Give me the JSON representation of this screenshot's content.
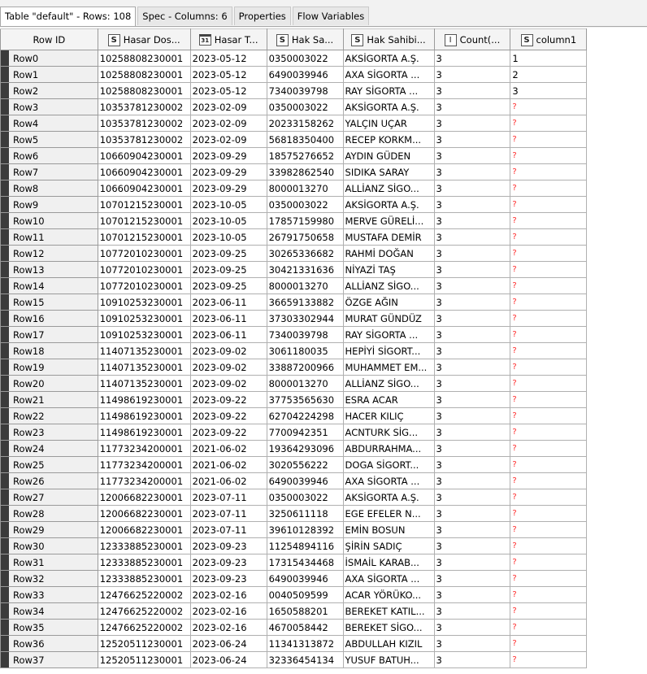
{
  "tabs": [
    {
      "label": "Table \"default\" - Rows: 108"
    },
    {
      "label": "Spec - Columns: 6"
    },
    {
      "label": "Properties"
    },
    {
      "label": "Flow Variables"
    }
  ],
  "columns": [
    {
      "label": "Row ID",
      "type": "",
      "icon": ""
    },
    {
      "label": "Hasar Dos...",
      "type": "S",
      "icon": "string-type-icon"
    },
    {
      "label": "Hasar T...",
      "type": "31",
      "icon": "date-type-icon"
    },
    {
      "label": "Hak Sa...",
      "type": "S",
      "icon": "string-type-icon"
    },
    {
      "label": "Hak Sahibi...",
      "type": "S",
      "icon": "string-type-icon"
    },
    {
      "label": "Count(...",
      "type": "I",
      "icon": "integer-type-icon"
    },
    {
      "label": "column1",
      "type": "S",
      "icon": "string-type-icon"
    }
  ],
  "rows": [
    [
      "Row0",
      "10258808230001",
      "2023-05-12",
      "0350003022",
      "AKSİGORTA A.Ş.",
      "3",
      "1"
    ],
    [
      "Row1",
      "10258808230001",
      "2023-05-12",
      "6490039946",
      "AXA SİGORTA ...",
      "3",
      "2"
    ],
    [
      "Row2",
      "10258808230001",
      "2023-05-12",
      "7340039798",
      "RAY SİGORTA ...",
      "3",
      "3"
    ],
    [
      "Row3",
      "10353781230002",
      "2023-02-09",
      "0350003022",
      "AKSİGORTA A.Ş.",
      "3",
      "?"
    ],
    [
      "Row4",
      "10353781230002",
      "2023-02-09",
      "20233158262",
      "YALÇIN UÇAR",
      "3",
      "?"
    ],
    [
      "Row5",
      "10353781230002",
      "2023-02-09",
      "56818350400",
      "RECEP KORKM...",
      "3",
      "?"
    ],
    [
      "Row6",
      "10660904230001",
      "2023-09-29",
      "18575276652",
      "AYDIN GÜDEN",
      "3",
      "?"
    ],
    [
      "Row7",
      "10660904230001",
      "2023-09-29",
      "33982862540",
      "SIDIKA SARAY",
      "3",
      "?"
    ],
    [
      "Row8",
      "10660904230001",
      "2023-09-29",
      "8000013270",
      "ALLİANZ SİGO...",
      "3",
      "?"
    ],
    [
      "Row9",
      "10701215230001",
      "2023-10-05",
      "0350003022",
      "AKSİGORTA A.Ş.",
      "3",
      "?"
    ],
    [
      "Row10",
      "10701215230001",
      "2023-10-05",
      "17857159980",
      "MERVE GÜRELİ...",
      "3",
      "?"
    ],
    [
      "Row11",
      "10701215230001",
      "2023-10-05",
      "26791750658",
      "MUSTAFA DEMİR",
      "3",
      "?"
    ],
    [
      "Row12",
      "10772010230001",
      "2023-09-25",
      "30265336682",
      "RAHMİ DOĞAN",
      "3",
      "?"
    ],
    [
      "Row13",
      "10772010230001",
      "2023-09-25",
      "30421331636",
      "NİYAZİ TAŞ",
      "3",
      "?"
    ],
    [
      "Row14",
      "10772010230001",
      "2023-09-25",
      "8000013270",
      "ALLİANZ SİGO...",
      "3",
      "?"
    ],
    [
      "Row15",
      "10910253230001",
      "2023-06-11",
      "36659133882",
      "ÖZGE AĞIN",
      "3",
      "?"
    ],
    [
      "Row16",
      "10910253230001",
      "2023-06-11",
      "37303302944",
      "MURAT GÜNDÜZ",
      "3",
      "?"
    ],
    [
      "Row17",
      "10910253230001",
      "2023-06-11",
      "7340039798",
      "RAY SİGORTA ...",
      "3",
      "?"
    ],
    [
      "Row18",
      "11407135230001",
      "2023-09-02",
      "3061180035",
      "HEPİYİ SİGORT...",
      "3",
      "?"
    ],
    [
      "Row19",
      "11407135230001",
      "2023-09-02",
      "33887200966",
      "MUHAMMET EM...",
      "3",
      "?"
    ],
    [
      "Row20",
      "11407135230001",
      "2023-09-02",
      "8000013270",
      "ALLİANZ SİGO...",
      "3",
      "?"
    ],
    [
      "Row21",
      "11498619230001",
      "2023-09-22",
      "37753565630",
      "ESRA ACAR",
      "3",
      "?"
    ],
    [
      "Row22",
      "11498619230001",
      "2023-09-22",
      "62704224298",
      "HACER KILIÇ",
      "3",
      "?"
    ],
    [
      "Row23",
      "11498619230001",
      "2023-09-22",
      "7700942351",
      "ACNTURK SİG...",
      "3",
      "?"
    ],
    [
      "Row24",
      "11773234200001",
      "2021-06-02",
      "19364293096",
      "ABDURRAHMA...",
      "3",
      "?"
    ],
    [
      "Row25",
      "11773234200001",
      "2021-06-02",
      "3020556222",
      "DOGA SİGORT...",
      "3",
      "?"
    ],
    [
      "Row26",
      "11773234200001",
      "2021-06-02",
      "6490039946",
      "AXA SİGORTA ...",
      "3",
      "?"
    ],
    [
      "Row27",
      "12006682230001",
      "2023-07-11",
      "0350003022",
      "AKSİGORTA A.Ş.",
      "3",
      "?"
    ],
    [
      "Row28",
      "12006682230001",
      "2023-07-11",
      "3250611118",
      "EGE EFELER N...",
      "3",
      "?"
    ],
    [
      "Row29",
      "12006682230001",
      "2023-07-11",
      "39610128392",
      "EMİN BOSUN",
      "3",
      "?"
    ],
    [
      "Row30",
      "12333885230001",
      "2023-09-23",
      "11254894116",
      "ŞİRİN SADIÇ",
      "3",
      "?"
    ],
    [
      "Row31",
      "12333885230001",
      "2023-09-23",
      "17315434468",
      "İSMAİL KARAB...",
      "3",
      "?"
    ],
    [
      "Row32",
      "12333885230001",
      "2023-09-23",
      "6490039946",
      "AXA SİGORTA ...",
      "3",
      "?"
    ],
    [
      "Row33",
      "12476625220002",
      "2023-02-16",
      "0040509599",
      "ACAR YÖRÜKO...",
      "3",
      "?"
    ],
    [
      "Row34",
      "12476625220002",
      "2023-02-16",
      "1650588201",
      "BEREKET KATIL...",
      "3",
      "?"
    ],
    [
      "Row35",
      "12476625220002",
      "2023-02-16",
      "4670058442",
      "BEREKET SİGO...",
      "3",
      "?"
    ],
    [
      "Row36",
      "12520511230001",
      "2023-06-24",
      "11341313872",
      "ABDULLAH KIZIL",
      "3",
      "?"
    ],
    [
      "Row37",
      "12520511230001",
      "2023-06-24",
      "32336454134",
      "YUSUF BATUH...",
      "3",
      "?"
    ]
  ],
  "colors": {
    "missing_value": "#ff2a2a",
    "row_marker": "#3b3b3b"
  }
}
